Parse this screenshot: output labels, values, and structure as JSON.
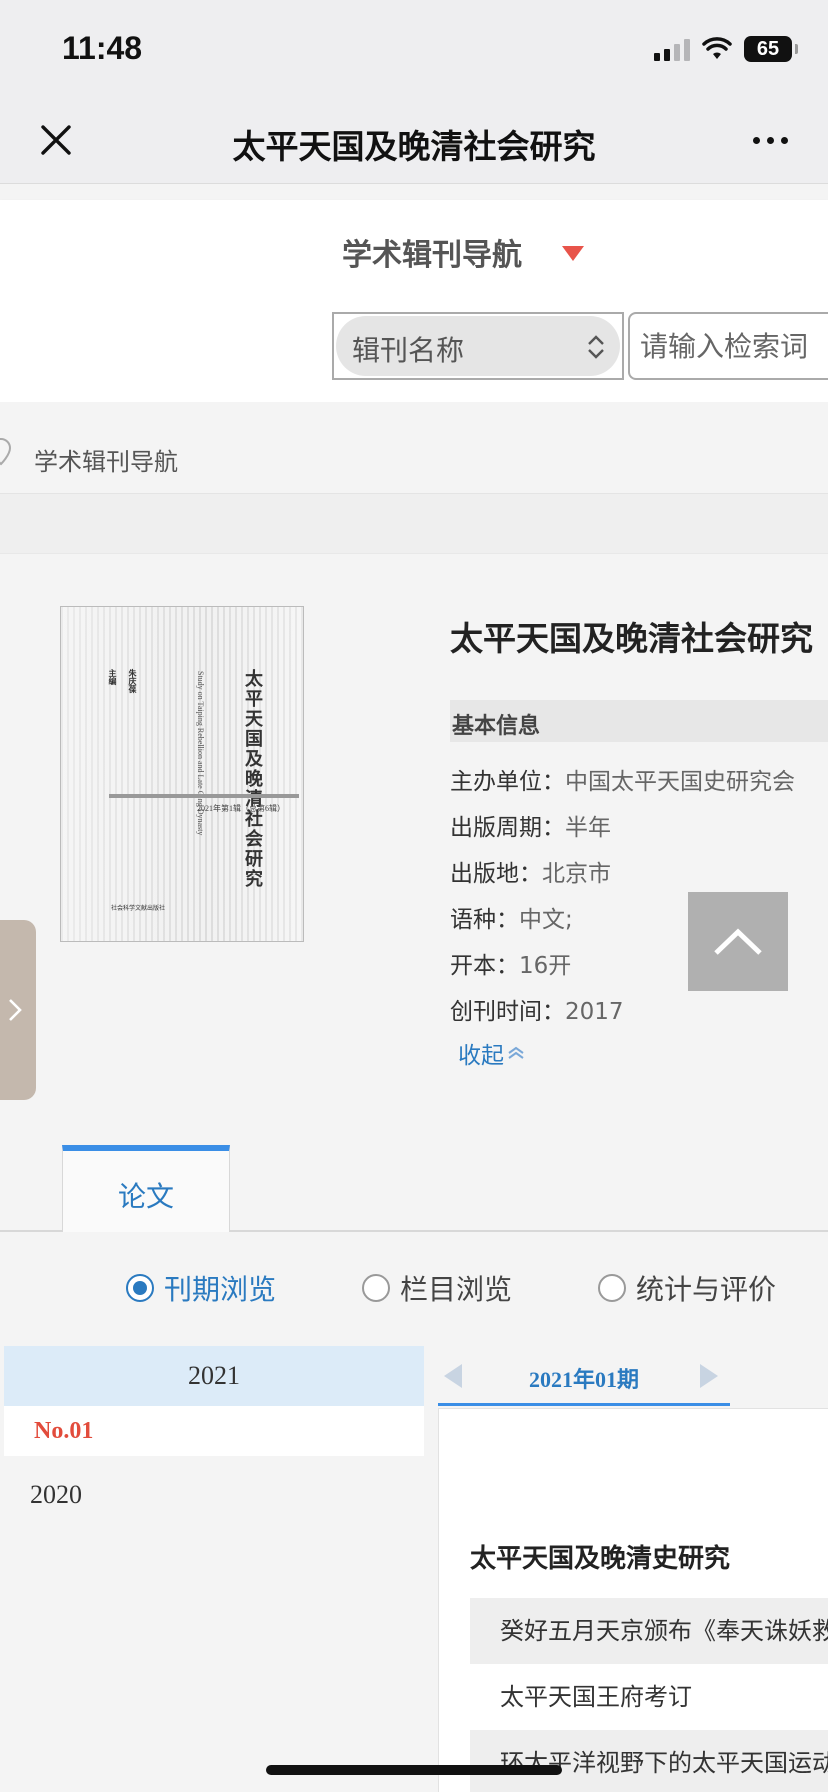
{
  "status_bar": {
    "time": "11:48",
    "battery": "65",
    "icons": [
      "signal-icon",
      "wifi-icon",
      "battery-icon"
    ]
  },
  "nav": {
    "title": "太平天国及晚清社会研究",
    "close_icon": "close-icon",
    "more_icon": "more-icon"
  },
  "header": {
    "title": "学术辑刊导航",
    "select_value": "辑刊名称",
    "search_placeholder": "请输入检索词"
  },
  "breadcrumb": {
    "label": "学术辑刊导航"
  },
  "cover": {
    "title": "太平天国及晚清社会研究",
    "subtitle_en": "Study on Taiping Rebellion and Late Qing Dynasty",
    "editor": "朱庆葆",
    "editor_role": "主编",
    "issue": "2021年第1辑（总第6辑）",
    "publisher": "社会科学文献出版社"
  },
  "journal": {
    "title": "太平天国及晚清社会研究",
    "section_basic": "基本信息",
    "fields": [
      {
        "label": "主办单位：",
        "value": "中国太平天国史研究会"
      },
      {
        "label": "出版周期：",
        "value": "半年"
      },
      {
        "label": "出版地：",
        "value": "北京市"
      },
      {
        "label": "语种：",
        "value": "中文;"
      },
      {
        "label": "开本：",
        "value": "16开"
      },
      {
        "label": "创刊时间：",
        "value": "2017"
      }
    ],
    "collapse_label": "收起"
  },
  "tabs": {
    "papers": "论文"
  },
  "browse_modes": [
    {
      "label": "刊期浏览",
      "checked": true
    },
    {
      "label": "栏目浏览",
      "checked": false
    },
    {
      "label": "统计与评价",
      "checked": false
    }
  ],
  "years": {
    "active_year": "2021",
    "active_issue": "No.01",
    "other_year": "2020"
  },
  "issue_panel": {
    "current_issue": "2021年01期",
    "section_title": "太平天国及晚清史研究",
    "articles": [
      "癸好五月天京颁布《奉天诛妖救世安民谕》",
      "太平天国王府考订",
      "环太平洋视野下的太平天国运动"
    ]
  },
  "colors": {
    "accent": "#2a7ac0",
    "active_issue": "#e24c3c",
    "caret": "#e8544a"
  }
}
